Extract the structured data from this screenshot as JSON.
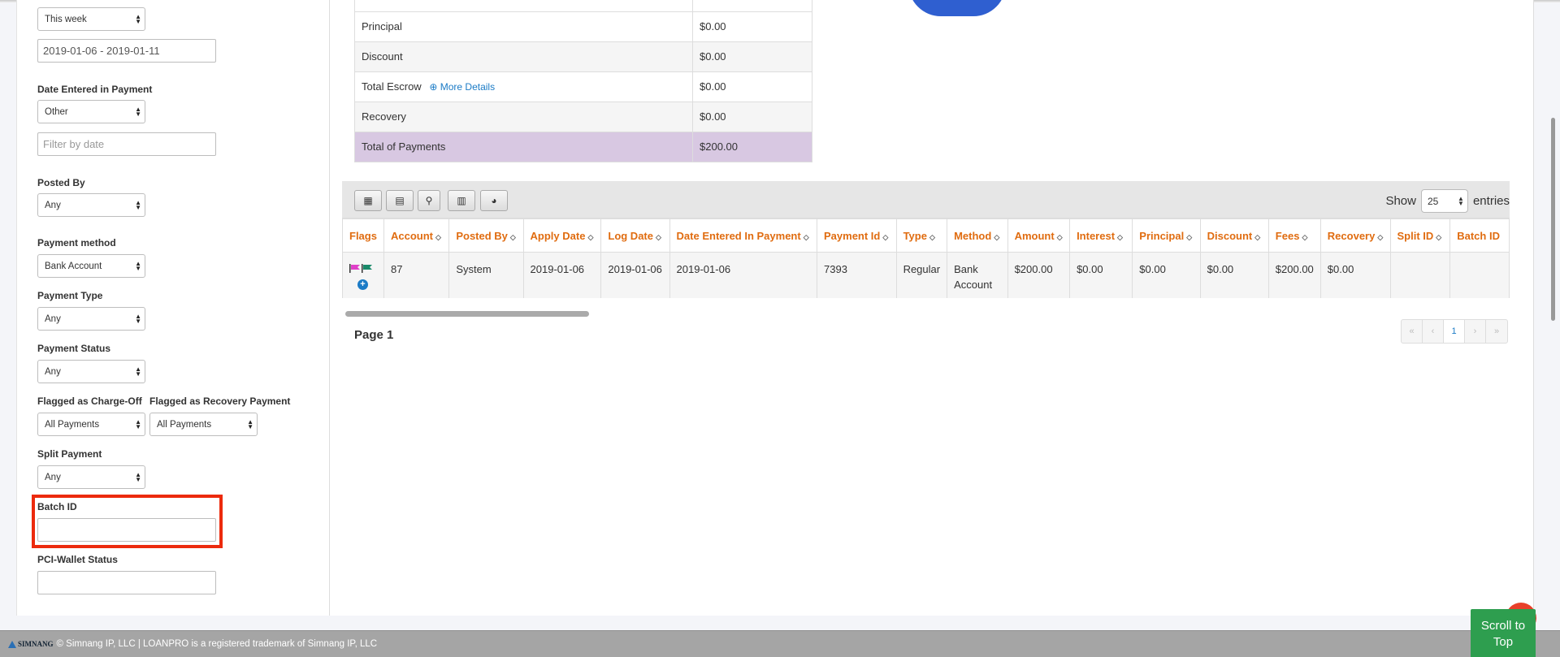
{
  "sidebar": {
    "date_range_select": "This week",
    "date_range_value": "2019-01-06 - 2019-01-11",
    "date_entered_label": "Date Entered in Payment",
    "date_entered_select": "Other",
    "date_entered_placeholder": "Filter by date",
    "posted_by_label": "Posted By",
    "posted_by_select": "Any",
    "payment_method_label": "Payment method",
    "payment_method_select": "Bank Account",
    "payment_type_label": "Payment Type",
    "payment_type_select": "Any",
    "payment_status_label": "Payment Status",
    "payment_status_select": "Any",
    "charge_off_label": "Flagged as Charge-Off",
    "charge_off_select": "All Payments",
    "recovery_label": "Flagged as Recovery Payment",
    "recovery_select": "All Payments",
    "split_label": "Split Payment",
    "split_select": "Any",
    "batch_label": "Batch ID",
    "batch_value": "",
    "pci_label": "PCI-Wallet Status",
    "pci_value": ""
  },
  "summary": {
    "rows": [
      {
        "label": "Principal",
        "value": "$0.00"
      },
      {
        "label": "Discount",
        "value": "$0.00"
      },
      {
        "label": "Total Escrow",
        "link": "More Details",
        "value": "$0.00"
      },
      {
        "label": "Recovery",
        "value": "$0.00"
      },
      {
        "label": "Total of Payments",
        "value": "$200.00"
      }
    ]
  },
  "toolbar": {
    "buttons": [
      "table-icon",
      "book-icon",
      "map-marker-icon",
      "bar-chart-icon",
      "pie-chart-icon"
    ],
    "show_label": "Show",
    "entries_value": "25",
    "entries_label": "entries"
  },
  "grid": {
    "columns": [
      "Flags",
      "Account",
      "Posted By",
      "Apply Date",
      "Log Date",
      "Date Entered In Payment",
      "Payment Id",
      "Type",
      "Method",
      "Amount",
      "Interest",
      "Principal",
      "Discount",
      "Fees",
      "Recovery",
      "Split ID",
      "Batch ID"
    ],
    "rows": [
      [
        "",
        "87",
        "System",
        "2019-01-06",
        "2019-01-06",
        "2019-01-06",
        "7393",
        "Regular",
        "Bank Account",
        "$200.00",
        "$0.00",
        "$0.00",
        "$0.00",
        "$200.00",
        "$0.00",
        "",
        ""
      ]
    ],
    "flag_colors": [
      "#e040c8",
      "#1a8a6a"
    ]
  },
  "pagination": {
    "page_label": "Page 1",
    "buttons": [
      "«",
      "‹",
      "1",
      "›",
      "»"
    ],
    "current": "1"
  },
  "footer": {
    "logo": "SIMNANG",
    "text": "© Simnang IP, LLC | LOANPRO is a registered trademark of Simnang IP, LLC"
  },
  "scroll_top": {
    "label": "Scroll to Top"
  }
}
